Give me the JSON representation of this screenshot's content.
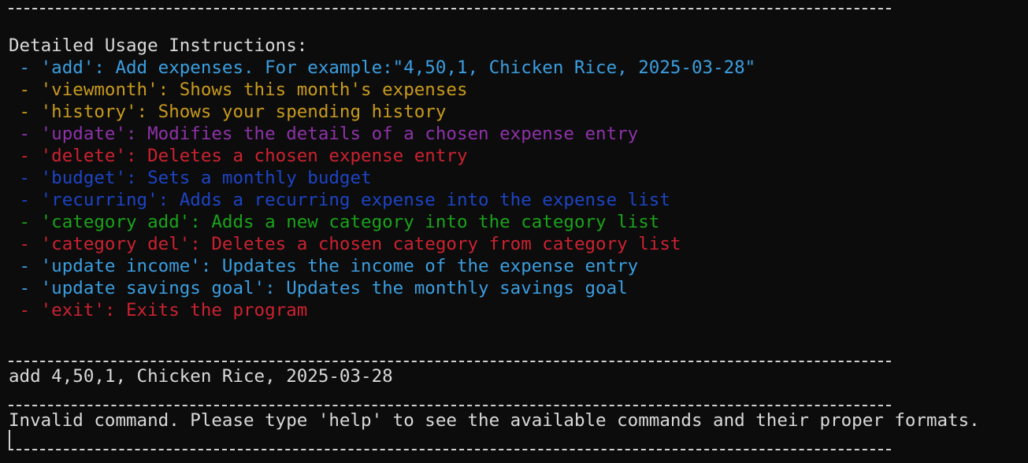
{
  "heading": "Detailed Usage Instructions:",
  "instructions": [
    {
      "text": " - 'add': Add expenses. For example:\"4,50,1, Chicken Rice, 2025-03-28\"",
      "color": "#3b9ee0"
    },
    {
      "text": " - 'viewmonth': Shows this month's expenses",
      "color": "#c89a1c"
    },
    {
      "text": " - 'history': Shows your spending history",
      "color": "#c89a1c"
    },
    {
      "text": " - 'update': Modifies the details of a chosen expense entry",
      "color": "#8e32a8"
    },
    {
      "text": " - 'delete': Deletes a chosen expense entry",
      "color": "#cc2230"
    },
    {
      "text": " - 'budget': Sets a monthly budget",
      "color": "#1d44c4"
    },
    {
      "text": " - 'recurring': Adds a recurring expense into the expense list",
      "color": "#1d44c4"
    },
    {
      "text": " - 'category add': Adds a new category into the category list",
      "color": "#1aa31a"
    },
    {
      "text": " - 'category del': Deletes a chosen category from category list",
      "color": "#cc2230"
    },
    {
      "text": " - 'update income': Updates the income of the expense entry",
      "color": "#3b9ee0"
    },
    {
      "text": " - 'update savings goal': Updates the monthly savings goal",
      "color": "#3b9ee0"
    },
    {
      "text": " - 'exit': Exits the program",
      "color": "#cc2230"
    }
  ],
  "user_input": "add 4,50,1, Chicken Rice, 2025-03-28",
  "error_message": "Invalid command. Please type 'help' to see the available commands and their proper formats."
}
